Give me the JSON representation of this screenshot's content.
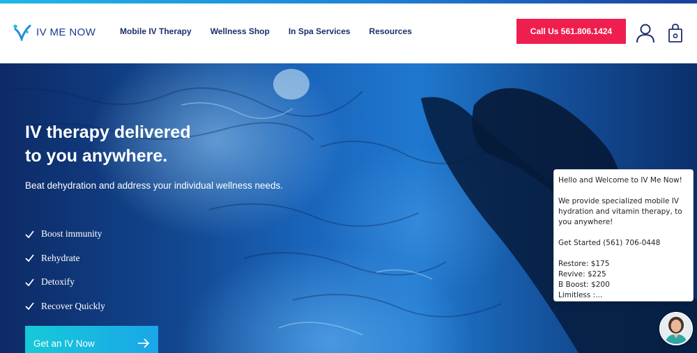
{
  "brand": {
    "name": "IV ME NOW"
  },
  "nav": {
    "items": [
      {
        "label": "Mobile IV Therapy"
      },
      {
        "label": "Wellness Shop"
      },
      {
        "label": "In Spa Services"
      },
      {
        "label": "Resources"
      }
    ],
    "call_label": "Call Us 561.806.1424"
  },
  "hero": {
    "headline_line1": "IV therapy delivered",
    "headline_line2": "to you anywhere.",
    "subheadline": "Beat dehydration and address your individual wellness needs.",
    "benefits": [
      {
        "label": "Boost immunity"
      },
      {
        "label": "Rehydrate"
      },
      {
        "label": "Detoxify"
      },
      {
        "label": "Recover Quickly"
      }
    ],
    "cta_label": "Get an IV Now"
  },
  "chat": {
    "greeting": "Hello and Welcome to IV Me Now!",
    "intro": "We provide specialized mobile IV hydration and vitamin therapy, to you anywhere!",
    "get_started": "Get Started (561) 706-0448",
    "prices": [
      "Restore: $175",
      "Revive: $225",
      "B Boost: $200",
      "Limitless :..."
    ]
  },
  "colors": {
    "brand_blue": "#1b3a8f",
    "call_red": "#ee1f4e",
    "cta_cyan": "#16c9d8"
  },
  "icons": [
    "logo-mark-icon",
    "user-icon",
    "shopping-bag-icon",
    "check-icon",
    "arrow-right-icon"
  ]
}
